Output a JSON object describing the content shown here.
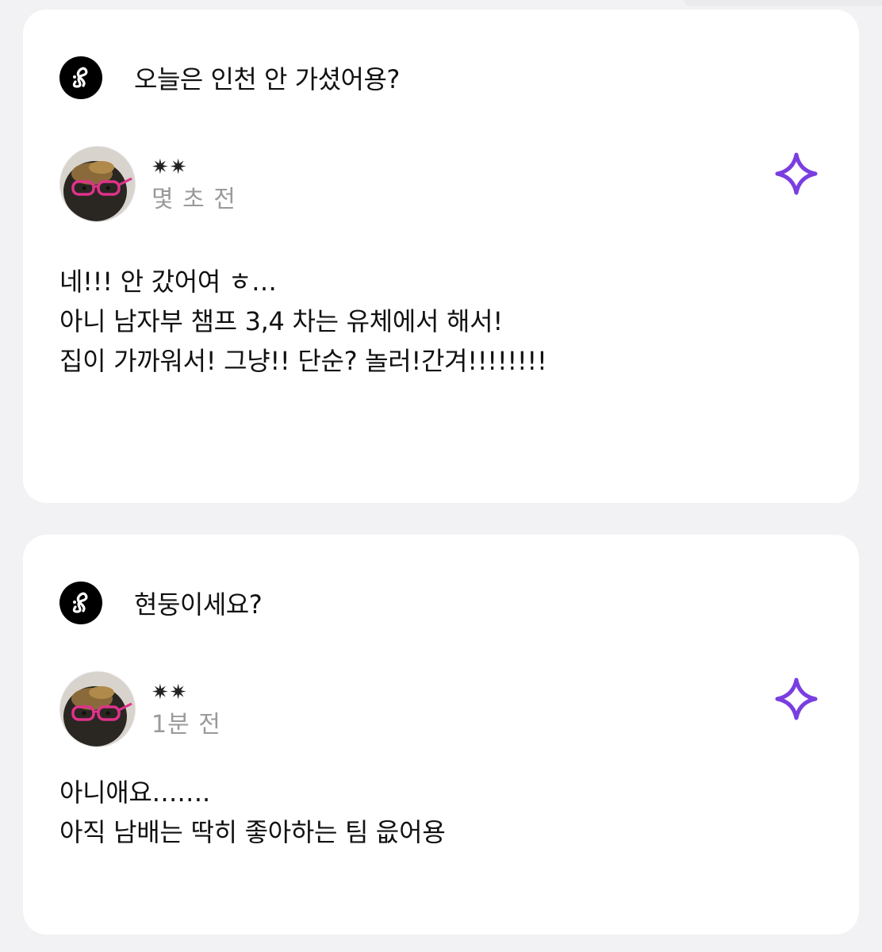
{
  "cards": [
    {
      "question": "오늘은 인천 안 가셨어용?",
      "author": {
        "name": "✷✷",
        "time": "몇 초 전"
      },
      "answer_lines": [
        "네!!! 안 갔어여 ㅎ…",
        "아니 남자부 챔프 3,4 차는 유체에서 해서!",
        "집이 가까워서! 그냥!! 단순? 놀러!간겨!!!!!!!!"
      ]
    },
    {
      "question": "현둥이세요?",
      "author": {
        "name": "✷✷",
        "time": "1분 전"
      },
      "answer_lines": [
        "아니애요…….",
        "아직 남배는 딱히 좋아하는 팀 읎어용"
      ]
    }
  ],
  "colors": {
    "background": "#f2f2f4",
    "card": "#ffffff",
    "accent": "#7a3ee0",
    "secondary_text": "#9a9a9a"
  },
  "icons": {
    "logo": "brand-logo-icon",
    "sparkle": "sparkle-icon"
  }
}
